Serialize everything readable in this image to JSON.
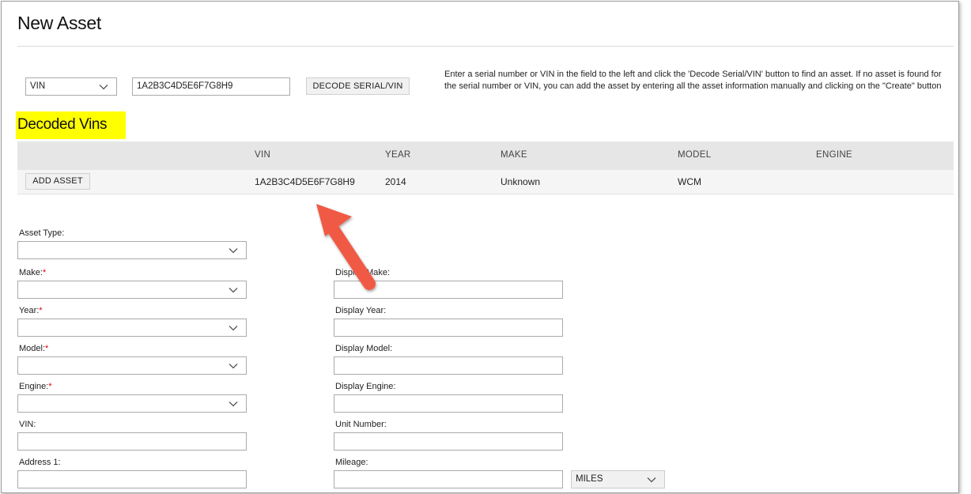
{
  "page": {
    "title": "New Asset"
  },
  "decode": {
    "type_select": "VIN",
    "serial_value": "1A2B3C4D5E6F7G8H9",
    "button_label": "DECODE SERIAL/VIN",
    "help_text": "Enter a serial number or VIN in the field to the left and click the 'Decode Serial/VIN' button to find an asset. If no asset is found for the serial number or VIN, you can add the asset by entering all the asset information manually and clicking on the \"Create\" button"
  },
  "decoded_vins": {
    "heading": "Decoded Vins",
    "columns": [
      "VIN",
      "YEAR",
      "MAKE",
      "MODEL",
      "ENGINE"
    ],
    "rows": [
      {
        "action_label": "ADD ASSET",
        "vin": "1A2B3C4D5E6F7G8H9",
        "year": "2014",
        "make": "Unknown",
        "model": "WCM",
        "engine": ""
      }
    ]
  },
  "form": {
    "asset_type_label": "Asset Type:",
    "make_label": "Make:",
    "year_label": "Year:",
    "model_label": "Model:",
    "engine_label": "Engine:",
    "vin_label": "VIN:",
    "address1_label": "Address 1:",
    "required_mark": "*",
    "display_make_label": "Display Make:",
    "display_year_label": "Display Year:",
    "display_model_label": "Display Model:",
    "display_engine_label": "Display Engine:",
    "unit_number_label": "Unit Number:",
    "mileage_label": "Mileage:",
    "mileage_unit": "MILES"
  },
  "colors": {
    "highlight": "#ffff00",
    "arrow": "#f05a45",
    "required": "#dd0000",
    "table_header_bg": "#e6e6e6"
  },
  "icons": [
    "chevron-down-icon",
    "annotation-arrow-icon"
  ]
}
